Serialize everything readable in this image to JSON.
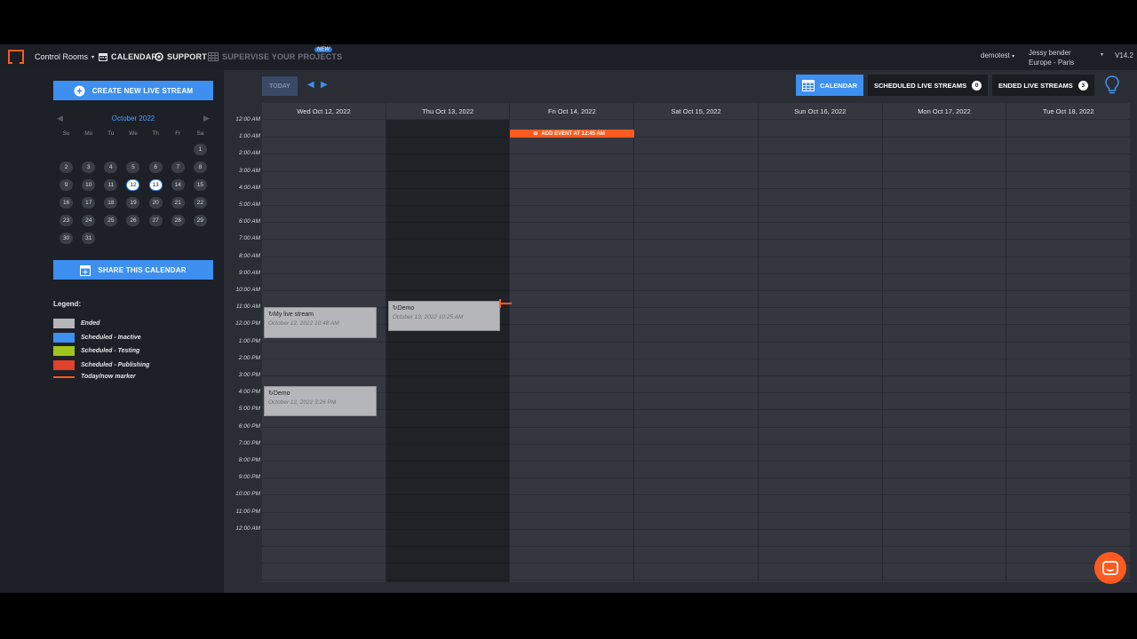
{
  "topbar": {
    "control_rooms": "Control Rooms",
    "calendar": "CALENDAR",
    "support": "SUPPORT",
    "supervise": "SUPERVISE YOUR PROJECTS",
    "new_badge": "NEW",
    "account": "demotest",
    "user_name": "Jessy bender",
    "timezone": "Europe - Paris",
    "version": "V14.2"
  },
  "sidebar": {
    "create_button": "CREATE NEW LIVE STREAM",
    "share_button": "SHARE THIS CALENDAR",
    "mini_calendar": {
      "month": "October 2022",
      "weekdays": [
        "Su",
        "Mo",
        "Tu",
        "We",
        "Th",
        "Fr",
        "Sa"
      ],
      "weeks": [
        [
          "",
          "",
          "",
          "",
          "",
          "",
          "1"
        ],
        [
          "2",
          "3",
          "4",
          "5",
          "6",
          "7",
          "8"
        ],
        [
          "9",
          "10",
          "11",
          "12",
          "13",
          "14",
          "15"
        ],
        [
          "16",
          "17",
          "18",
          "19",
          "20",
          "21",
          "22"
        ],
        [
          "23",
          "24",
          "25",
          "26",
          "27",
          "28",
          "29"
        ],
        [
          "30",
          "31",
          "",
          "",
          "",
          "",
          ""
        ]
      ],
      "highlighted": [
        "12",
        "13"
      ]
    },
    "legend_title": "Legend:",
    "legend": [
      {
        "label": "Ended",
        "color": "#b5b6b9",
        "kind": "swatch"
      },
      {
        "label": "Scheduled - Inactive",
        "color": "#3d8ff0",
        "kind": "swatch"
      },
      {
        "label": "Scheduled - Testing",
        "color": "#9fc51a",
        "kind": "swatch"
      },
      {
        "label": "Scheduled - Publishing",
        "color": "#e2412a",
        "kind": "swatch"
      },
      {
        "label": "Today/now marker",
        "color": "#ff5a1f",
        "kind": "line"
      }
    ]
  },
  "toolbar": {
    "today": "TODAY",
    "calendar_tab": "CALENDAR",
    "scheduled_tab": "SCHEDULED LIVE STREAMS",
    "scheduled_count": "0",
    "ended_tab": "ENDED LIVE STREAMS",
    "ended_count": "3"
  },
  "week": {
    "days": [
      "Wed Oct 12, 2022",
      "Thu Oct 13, 2022",
      "Fri Oct 14, 2022",
      "Sat Oct 15, 2022",
      "Sun Oct 16, 2022",
      "Mon Oct 17, 2022",
      "Tue Oct 18, 2022"
    ],
    "today_index": 1,
    "hours": [
      "12:00 AM",
      "1:00 AM",
      "2:00 AM",
      "3:00 AM",
      "4:00 AM",
      "5:00 AM",
      "6:00 AM",
      "7:00 AM",
      "8:00 AM",
      "9:00 AM",
      "10:00 AM",
      "11:00 AM",
      "12:00 PM",
      "1:00 PM",
      "2:00 PM",
      "3:00 PM",
      "4:00 PM",
      "5:00 PM",
      "6:00 PM",
      "7:00 PM",
      "8:00 PM",
      "9:00 PM",
      "10:00 PM",
      "11:00 PM",
      "12:00 AM"
    ],
    "events": [
      {
        "day": 0,
        "start_hour": 11.0,
        "end_hour": 12.8,
        "title": "My live stream",
        "date": "October 12, 2022 10:48 AM",
        "status": "ended"
      },
      {
        "day": 1,
        "start_hour": 10.6,
        "end_hour": 12.4,
        "title": "Demo",
        "date": "October 13, 2022 10:25 AM",
        "status": "ended"
      },
      {
        "day": 0,
        "start_hour": 15.6,
        "end_hour": 17.4,
        "title": "Demo",
        "date": "October 12, 2022 3:26 PM",
        "status": "ended"
      }
    ],
    "add_event": {
      "day": 2,
      "label": "ADD EVENT AT 12:45 AM",
      "hour": 0.75
    },
    "now_marker_hour": 10.75
  }
}
